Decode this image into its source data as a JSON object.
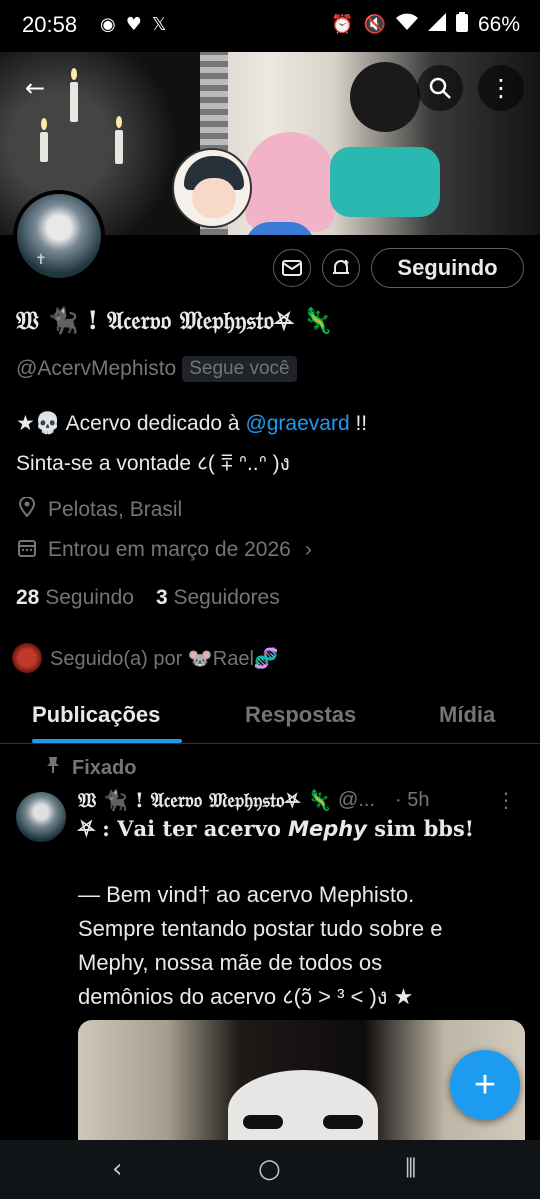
{
  "status_bar": {
    "time": "20:58",
    "battery": "66%",
    "left_icons": [
      "app-icon",
      "heart-icon",
      "x-icon"
    ],
    "right_icons": [
      "alarm-icon",
      "mute-icon",
      "wifi-icon",
      "signal-icon",
      "battery-icon"
    ]
  },
  "header": {
    "back_icon": "←",
    "search_icon": "⌕",
    "more_icon": "⋮"
  },
  "profile": {
    "display_name": "𝔚 🐈‍⬛ ! 𝔄𝔠𝔢𝔯𝔳𝔬 𝔐𝔢𝔭𝔥𝔶𝔰𝔱𝔬⛧ 🦎",
    "handle": "@AcervMephisto",
    "follows_you": "Segue você",
    "bio_line1_prefix": "★💀 Acervo dedicado à ",
    "bio_mention": "@graevard",
    "bio_line1_suffix": " !!",
    "bio_line2": "Sinta-se a vontade ८( ⩱ ᐢ..ᐢ  )ง",
    "location": "Pelotas, Brasil",
    "joined": "Entrou em março de 2026",
    "following_count": "28",
    "following_label": "Seguindo",
    "followers_count": "3",
    "followers_label": "Seguidores",
    "followed_by": "Seguido(a) por 🐭Rael🧬",
    "follow_button": "Seguindo"
  },
  "tabs": [
    {
      "label": "Publicações",
      "active": true
    },
    {
      "label": "Respostas",
      "active": false
    },
    {
      "label": "Mídia",
      "active": false
    }
  ],
  "post": {
    "pinned_label": "Fixado",
    "author_name": "𝔚 🐈‍⬛ ! 𝔄𝔠𝔢𝔯𝔳𝔬 𝔐𝔢𝔭𝔥𝔶𝔰𝔱𝔬⛧ 🦎",
    "author_handle": "@...",
    "time": "· 5h",
    "line1": "⛧ : 𝐕𝐚𝐢 𝐭𝐞𝐫 𝐚𝐜𝐞𝐫𝐯𝐨 𝙈𝙚𝙥𝙝𝙮 𝐬𝐢𝐦 𝐛𝐛𝐬!",
    "body_lines": [
      "— Bem vind† ao acervo Mephisto.",
      "Sempre tentando postar tudo sobre e",
      "Mephy, nossa mãe de todos os",
      "demônios do acervo ८(ɔ̃ ˃ ³ ˂ )ง ★"
    ]
  },
  "fab_label": "+",
  "android_nav": {
    "back": "‹",
    "home": "○",
    "recents": "⦀"
  },
  "colors": {
    "accent": "#1d9bf0",
    "background": "#000000",
    "muted_text": "#71767b",
    "text": "#e7e9ea"
  }
}
